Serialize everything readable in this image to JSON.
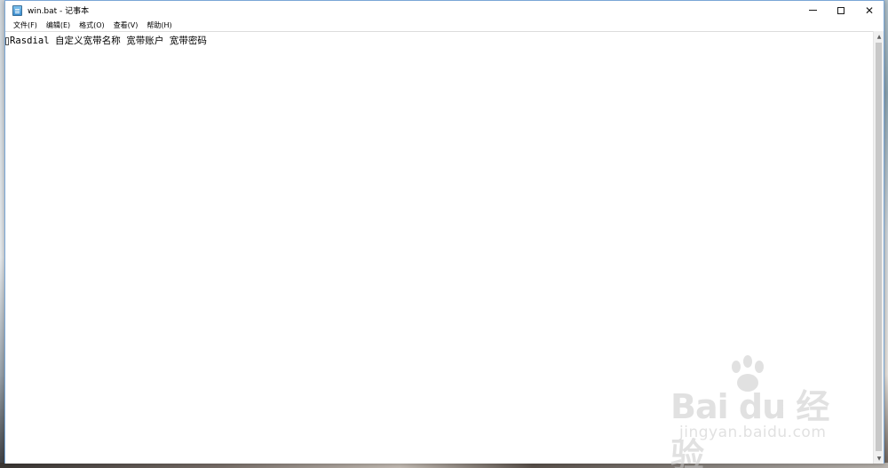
{
  "window": {
    "title": "win.bat - 记事本",
    "minimize_label": "—",
    "maximize_label": "☐",
    "close_label": "✕"
  },
  "menu": {
    "items": [
      {
        "label": "文件(F)"
      },
      {
        "label": "编辑(E)"
      },
      {
        "label": "格式(O)"
      },
      {
        "label": "查看(V)"
      },
      {
        "label": "帮助(H)"
      }
    ]
  },
  "editor": {
    "content": "Rasdial 自定义宽带名称 宽带账户 宽带密码"
  },
  "scrollbar": {
    "up_arrow": "▲",
    "down_arrow": "▼"
  },
  "watermark": {
    "logo_text": "Bai du 经验",
    "url_text": "jingyan.baidu.com"
  },
  "icons": {
    "app": "notepad-icon",
    "paw": "paw-icon"
  }
}
